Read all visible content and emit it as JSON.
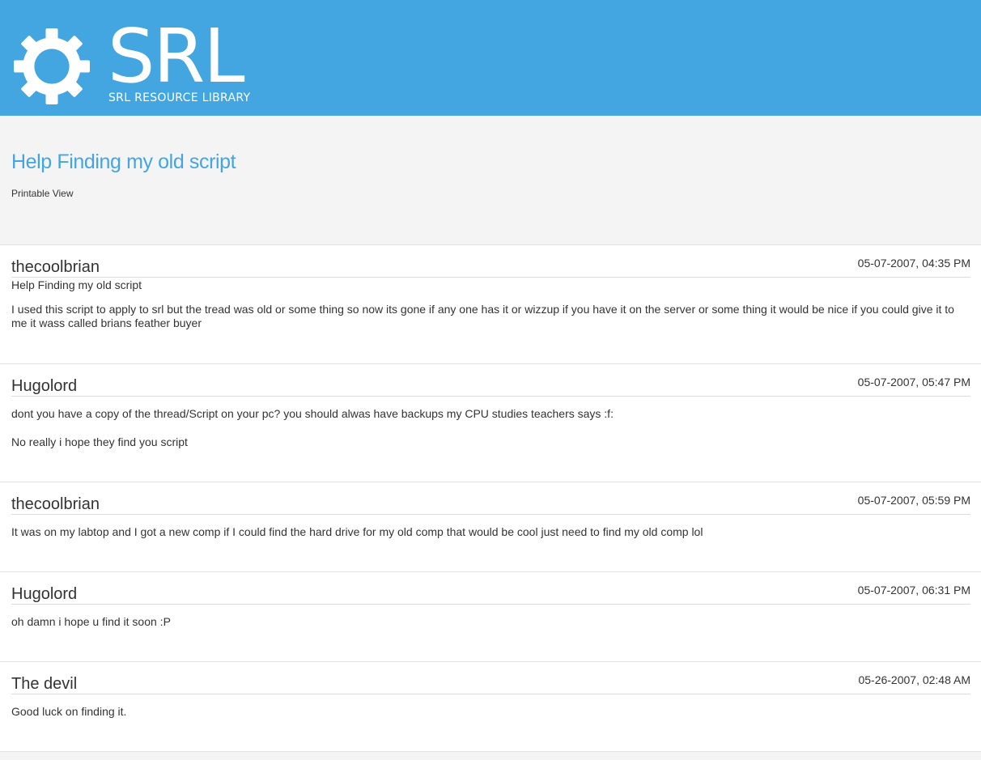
{
  "header": {
    "logo_text": "SRL",
    "logo_subtitle": "SRL RESOURCE LIBRARY",
    "brand_color": "#44a6e0"
  },
  "page": {
    "title": "Help Finding my old script",
    "printable_view": "Printable View"
  },
  "posts": [
    {
      "author": "thecoolbrian",
      "date": "05-07-2007, 04:35 PM",
      "title": "Help Finding my old script",
      "body": [
        "I used this script to apply to srl but the tread was old or some thing so now its gone if any one has it or wizzup if you have it on the server or some thing it would be nice if you could give it to me it wass called brians feather buyer"
      ]
    },
    {
      "author": "Hugolord",
      "date": "05-07-2007, 05:47 PM",
      "body": [
        "dont you have a copy of the thread/Script on your pc? you should alwas have backups my CPU studies teachers says :f:",
        "No really i hope they find you script"
      ]
    },
    {
      "author": "thecoolbrian",
      "date": "05-07-2007, 05:59 PM",
      "body": [
        "It was on my labtop and I got a new comp if I could find the hard drive for my old comp that would be cool just need to find my old comp lol"
      ]
    },
    {
      "author": "Hugolord",
      "date": "05-07-2007, 06:31 PM",
      "body": [
        "oh damn i hope u find it soon :P"
      ]
    },
    {
      "author": "The devil",
      "date": "05-26-2007, 02:48 AM",
      "body": [
        "Good luck on finding it."
      ]
    }
  ]
}
